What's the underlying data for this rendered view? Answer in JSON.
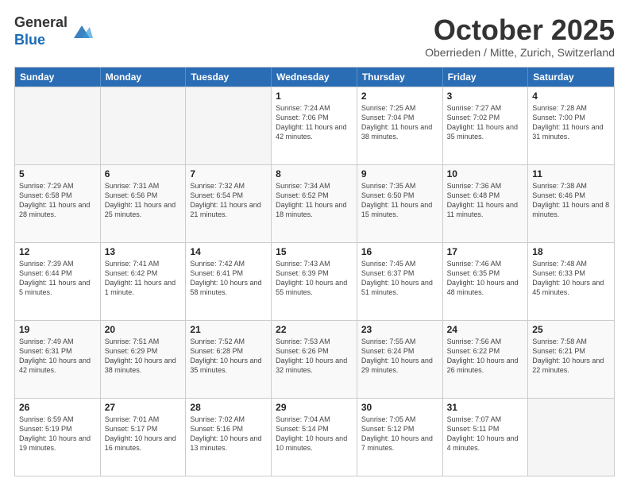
{
  "header": {
    "logo_line1": "General",
    "logo_line2": "Blue",
    "month_title": "October 2025",
    "location": "Oberrieden / Mitte, Zurich, Switzerland"
  },
  "weekdays": [
    "Sunday",
    "Monday",
    "Tuesday",
    "Wednesday",
    "Thursday",
    "Friday",
    "Saturday"
  ],
  "rows": [
    [
      {
        "day": "",
        "info": ""
      },
      {
        "day": "",
        "info": ""
      },
      {
        "day": "",
        "info": ""
      },
      {
        "day": "1",
        "info": "Sunrise: 7:24 AM\nSunset: 7:06 PM\nDaylight: 11 hours\nand 42 minutes."
      },
      {
        "day": "2",
        "info": "Sunrise: 7:25 AM\nSunset: 7:04 PM\nDaylight: 11 hours\nand 38 minutes."
      },
      {
        "day": "3",
        "info": "Sunrise: 7:27 AM\nSunset: 7:02 PM\nDaylight: 11 hours\nand 35 minutes."
      },
      {
        "day": "4",
        "info": "Sunrise: 7:28 AM\nSunset: 7:00 PM\nDaylight: 11 hours\nand 31 minutes."
      }
    ],
    [
      {
        "day": "5",
        "info": "Sunrise: 7:29 AM\nSunset: 6:58 PM\nDaylight: 11 hours\nand 28 minutes."
      },
      {
        "day": "6",
        "info": "Sunrise: 7:31 AM\nSunset: 6:56 PM\nDaylight: 11 hours\nand 25 minutes."
      },
      {
        "day": "7",
        "info": "Sunrise: 7:32 AM\nSunset: 6:54 PM\nDaylight: 11 hours\nand 21 minutes."
      },
      {
        "day": "8",
        "info": "Sunrise: 7:34 AM\nSunset: 6:52 PM\nDaylight: 11 hours\nand 18 minutes."
      },
      {
        "day": "9",
        "info": "Sunrise: 7:35 AM\nSunset: 6:50 PM\nDaylight: 11 hours\nand 15 minutes."
      },
      {
        "day": "10",
        "info": "Sunrise: 7:36 AM\nSunset: 6:48 PM\nDaylight: 11 hours\nand 11 minutes."
      },
      {
        "day": "11",
        "info": "Sunrise: 7:38 AM\nSunset: 6:46 PM\nDaylight: 11 hours\nand 8 minutes."
      }
    ],
    [
      {
        "day": "12",
        "info": "Sunrise: 7:39 AM\nSunset: 6:44 PM\nDaylight: 11 hours\nand 5 minutes."
      },
      {
        "day": "13",
        "info": "Sunrise: 7:41 AM\nSunset: 6:42 PM\nDaylight: 11 hours\nand 1 minute."
      },
      {
        "day": "14",
        "info": "Sunrise: 7:42 AM\nSunset: 6:41 PM\nDaylight: 10 hours\nand 58 minutes."
      },
      {
        "day": "15",
        "info": "Sunrise: 7:43 AM\nSunset: 6:39 PM\nDaylight: 10 hours\nand 55 minutes."
      },
      {
        "day": "16",
        "info": "Sunrise: 7:45 AM\nSunset: 6:37 PM\nDaylight: 10 hours\nand 51 minutes."
      },
      {
        "day": "17",
        "info": "Sunrise: 7:46 AM\nSunset: 6:35 PM\nDaylight: 10 hours\nand 48 minutes."
      },
      {
        "day": "18",
        "info": "Sunrise: 7:48 AM\nSunset: 6:33 PM\nDaylight: 10 hours\nand 45 minutes."
      }
    ],
    [
      {
        "day": "19",
        "info": "Sunrise: 7:49 AM\nSunset: 6:31 PM\nDaylight: 10 hours\nand 42 minutes."
      },
      {
        "day": "20",
        "info": "Sunrise: 7:51 AM\nSunset: 6:29 PM\nDaylight: 10 hours\nand 38 minutes."
      },
      {
        "day": "21",
        "info": "Sunrise: 7:52 AM\nSunset: 6:28 PM\nDaylight: 10 hours\nand 35 minutes."
      },
      {
        "day": "22",
        "info": "Sunrise: 7:53 AM\nSunset: 6:26 PM\nDaylight: 10 hours\nand 32 minutes."
      },
      {
        "day": "23",
        "info": "Sunrise: 7:55 AM\nSunset: 6:24 PM\nDaylight: 10 hours\nand 29 minutes."
      },
      {
        "day": "24",
        "info": "Sunrise: 7:56 AM\nSunset: 6:22 PM\nDaylight: 10 hours\nand 26 minutes."
      },
      {
        "day": "25",
        "info": "Sunrise: 7:58 AM\nSunset: 6:21 PM\nDaylight: 10 hours\nand 22 minutes."
      }
    ],
    [
      {
        "day": "26",
        "info": "Sunrise: 6:59 AM\nSunset: 5:19 PM\nDaylight: 10 hours\nand 19 minutes."
      },
      {
        "day": "27",
        "info": "Sunrise: 7:01 AM\nSunset: 5:17 PM\nDaylight: 10 hours\nand 16 minutes."
      },
      {
        "day": "28",
        "info": "Sunrise: 7:02 AM\nSunset: 5:16 PM\nDaylight: 10 hours\nand 13 minutes."
      },
      {
        "day": "29",
        "info": "Sunrise: 7:04 AM\nSunset: 5:14 PM\nDaylight: 10 hours\nand 10 minutes."
      },
      {
        "day": "30",
        "info": "Sunrise: 7:05 AM\nSunset: 5:12 PM\nDaylight: 10 hours\nand 7 minutes."
      },
      {
        "day": "31",
        "info": "Sunrise: 7:07 AM\nSunset: 5:11 PM\nDaylight: 10 hours\nand 4 minutes."
      },
      {
        "day": "",
        "info": ""
      }
    ]
  ]
}
